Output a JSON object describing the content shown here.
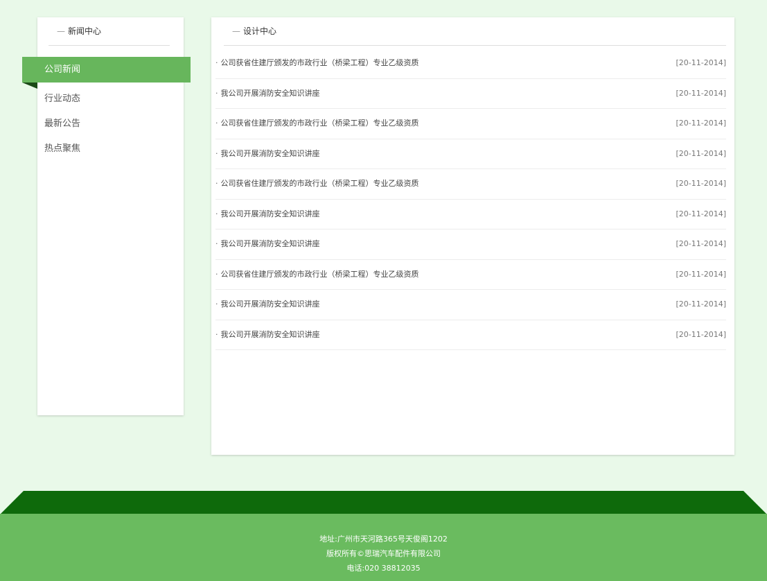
{
  "sidebar": {
    "title": "新闻中心",
    "items": [
      {
        "label": "公司新闻",
        "active": true
      },
      {
        "label": "行业动态",
        "active": false
      },
      {
        "label": "最新公告",
        "active": false
      },
      {
        "label": "热点聚焦",
        "active": false
      }
    ]
  },
  "main": {
    "title": "设计中心",
    "news": [
      {
        "title": "公司获省住建厅颁发的市政行业（桥梁工程）专业乙级资质",
        "date": "[20-11-2014]"
      },
      {
        "title": "我公司开展消防安全知识讲座",
        "date": "[20-11-2014]"
      },
      {
        "title": "公司获省住建厅颁发的市政行业（桥梁工程）专业乙级资质",
        "date": "[20-11-2014]"
      },
      {
        "title": "我公司开展消防安全知识讲座",
        "date": "[20-11-2014]"
      },
      {
        "title": "公司获省住建厅颁发的市政行业（桥梁工程）专业乙级资质",
        "date": "[20-11-2014]"
      },
      {
        "title": "我公司开展消防安全知识讲座",
        "date": "[20-11-2014]"
      },
      {
        "title": "我公司开展消防安全知识讲座",
        "date": "[20-11-2014]"
      },
      {
        "title": "公司获省住建厅颁发的市政行业（桥梁工程）专业乙级资质",
        "date": "[20-11-2014]"
      },
      {
        "title": "我公司开展消防安全知识讲座",
        "date": "[20-11-2014]"
      },
      {
        "title": "我公司开展消防安全知识讲座",
        "date": "[20-11-2014]"
      }
    ]
  },
  "footer": {
    "address": "地址:广州市天河路365号天俊阁1202",
    "copyright": "版权所有©思瑞汽车配件有限公司",
    "phone": "电话:020 38812035"
  },
  "colors": {
    "page_bg": "#e9f9e9",
    "accent_green": "#67b65c",
    "dark_green": "#0e6a0b"
  }
}
